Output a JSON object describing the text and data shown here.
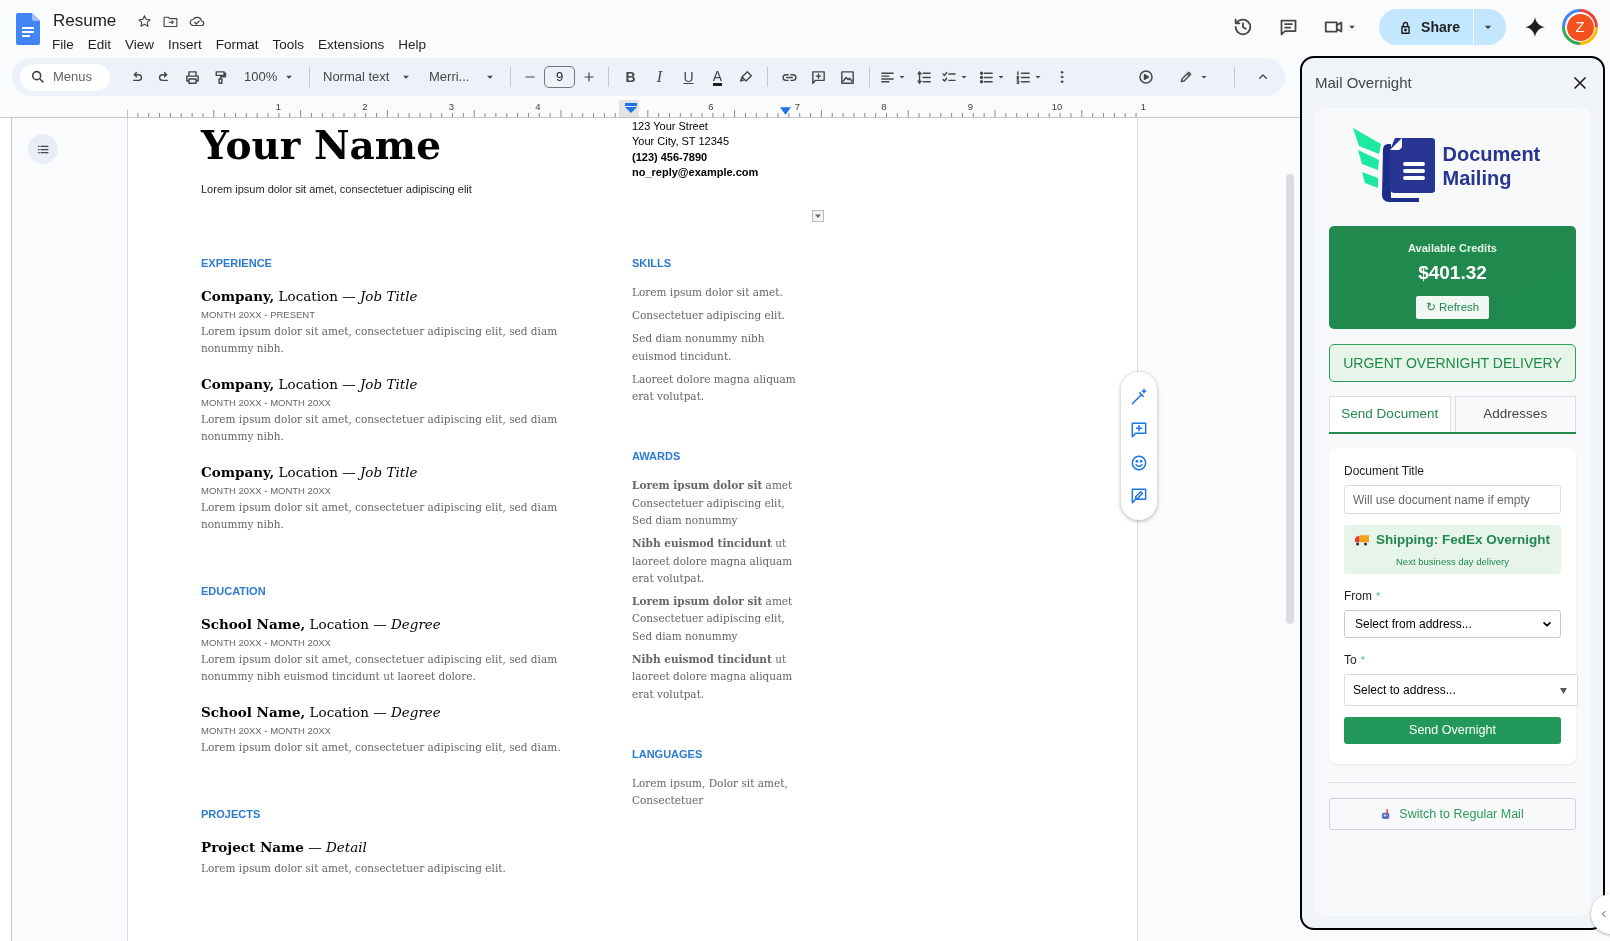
{
  "docs": {
    "title": "Resume",
    "menu": [
      "File",
      "Edit",
      "View",
      "Insert",
      "Format",
      "Tools",
      "Extensions",
      "Help"
    ],
    "share": "Share",
    "avatar": "Z",
    "toolbar": {
      "search_placeholder": "Menus",
      "zoom": "100%",
      "style": "Normal text",
      "font": "Merri...",
      "font_size": "9",
      "format_buttons": [
        "B",
        "I",
        "U",
        "A"
      ]
    },
    "ruler": [
      "1",
      "2",
      "3",
      "4",
      "6",
      "7",
      "8",
      "9",
      "10",
      "1"
    ]
  },
  "resume": {
    "name": "Your Name",
    "tagline": "Lorem ipsum dolor sit amet, consectetuer adipiscing elit",
    "contact": [
      {
        "text": "123 Your Street",
        "bold": false
      },
      {
        "text": "Your City, ST 12345",
        "bold": false
      },
      {
        "text": "(123) 456-7890",
        "bold": true
      },
      {
        "text": "no_reply@example.com",
        "bold": true
      }
    ],
    "left_sections": [
      {
        "heading": "EXPERIENCE",
        "entries": [
          {
            "title": "**Company,** Location — *Job Title*",
            "date": "MONTH 20XX - PRESENT",
            "description": "Lorem ipsum dolor sit amet, consectetuer adipiscing elit, sed diam nonummy nibh."
          },
          {
            "title": "**Company,** Location — *Job Title*",
            "date": "MONTH 20XX - MONTH 20XX",
            "description": "Lorem ipsum dolor sit amet, consectetuer adipiscing elit, sed diam nonummy nibh."
          },
          {
            "title": "**Company,** Location — *Job Title*",
            "date": "MONTH 20XX - MONTH 20XX",
            "description": "Lorem ipsum dolor sit amet, consectetuer adipiscing elit, sed diam nonummy nibh."
          }
        ]
      },
      {
        "heading": "EDUCATION",
        "entries": [
          {
            "title": "**School Name,** Location — *Degree*",
            "date": "MONTH 20XX - MONTH 20XX",
            "description": "Lorem ipsum dolor sit amet, consectetuer adipiscing elit, sed diam nonummy nibh euismod tincidunt ut laoreet dolore."
          },
          {
            "title": "**School Name,** Location — *Degree*",
            "date": "MONTH 20XX - MONTH 20XX",
            "description": "Lorem ipsum dolor sit amet, consectetuer adipiscing elit, sed diam."
          }
        ]
      },
      {
        "heading": "PROJECTS",
        "entries": [
          {
            "title": "**Project Name** — *Detail*",
            "description": "Lorem ipsum dolor sit amet, consectetuer adipiscing elit."
          }
        ]
      }
    ],
    "right_sections": [
      {
        "heading": "SKILLS",
        "items": [
          "Lorem ipsum dolor sit amet.",
          "Consectetuer adipiscing elit.",
          "Sed diam nonummy nibh euismod tincidunt.",
          "Laoreet dolore magna aliquam erat volutpat."
        ]
      },
      {
        "heading": "AWARDS",
        "items": [
          "**Lorem ipsum dolor sit** amet Consectetuer adipiscing elit, Sed diam nonummy",
          "**Nibh euismod tincidunt** ut laoreet dolore magna aliquam erat volutpat.",
          "**Lorem ipsum dolor sit** amet Consectetuer adipiscing elit, Sed diam nonummy",
          "**Nibh euismod tincidunt** ut laoreet dolore magna aliquam erat volutpat."
        ]
      },
      {
        "heading": "LANGUAGES",
        "items": [
          "Lorem ipsum, Dolor sit amet, Consectetuer"
        ]
      }
    ]
  },
  "panel": {
    "title": "Mail Overnight",
    "brand": "Document Mailing",
    "credits": {
      "label": "Available Credits",
      "amount": "$401.32",
      "refresh": "↻ Refresh"
    },
    "urgent": "URGENT OVERNIGHT DELIVERY",
    "tabs": [
      {
        "label": "Send Document",
        "selected": true
      },
      {
        "label": "Addresses",
        "selected": false
      }
    ],
    "form": {
      "title_label": "Document Title",
      "title_placeholder": "Will use document name if empty",
      "shipping": "Shipping: FedEx Overnight",
      "shipping_note": "Next business day delivery",
      "from_label": "From",
      "from_required": "*",
      "from_value": "Select from address...",
      "to_label": "To",
      "to_required": "*",
      "to_value": "Select to address...",
      "submit": "Send Overnight"
    },
    "switch": "Switch to Regular Mail"
  }
}
